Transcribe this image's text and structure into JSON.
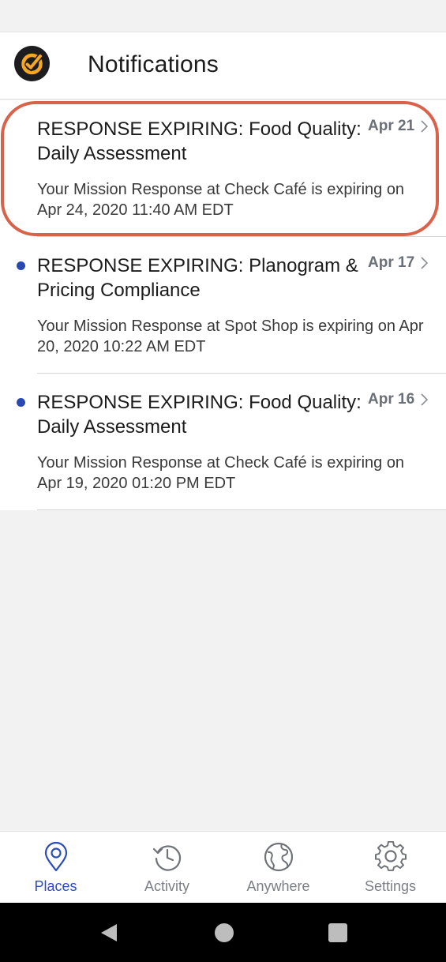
{
  "header": {
    "title": "Notifications",
    "logo_icon": "checkmark-circle-logo-icon"
  },
  "notifications": [
    {
      "title": "RESPONSE EXPIRING: Food Quality: Daily Assessment",
      "date": "Apr 21",
      "body": "Your Mission Response at Check Café is expiring on Apr 24, 2020 11:40 AM EDT",
      "unread": false,
      "highlighted": true
    },
    {
      "title": "RESPONSE EXPIRING: Planogram & Pricing Compliance",
      "date": "Apr 17",
      "body": "Your Mission Response at Spot Shop is expiring on Apr 20, 2020 10:22 AM EDT",
      "unread": true,
      "highlighted": false
    },
    {
      "title": "RESPONSE EXPIRING: Food Quality: Daily Assessment",
      "date": "Apr 16",
      "body": "Your Mission Response at Check Café is expiring on Apr 19, 2020 01:20 PM EDT",
      "unread": true,
      "highlighted": false
    }
  ],
  "tabbar": {
    "tabs": [
      {
        "label": "Places",
        "icon": "map-pin-icon",
        "active": true
      },
      {
        "label": "Activity",
        "icon": "history-clock-icon",
        "active": false
      },
      {
        "label": "Anywhere",
        "icon": "globe-icon",
        "active": false
      },
      {
        "label": "Settings",
        "icon": "gear-icon",
        "active": false
      }
    ]
  },
  "system_nav": {
    "buttons": [
      "back-triangle-icon",
      "home-circle-icon",
      "recents-square-icon"
    ]
  },
  "colors": {
    "accent": "#2b4dbb",
    "unread_dot": "#2849b4",
    "highlight_ring": "#d9634a",
    "logo_orange": "#f5a623"
  }
}
